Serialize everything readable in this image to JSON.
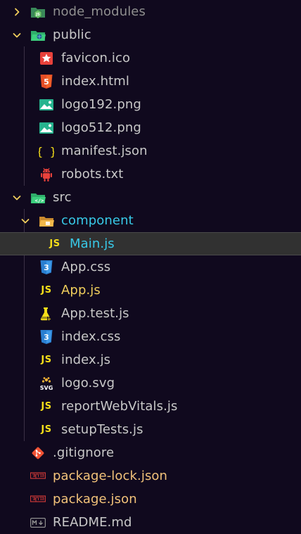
{
  "explorer": {
    "items": [
      {
        "label": "node_modules",
        "icon": "node-folder-icon",
        "color": "#8f8f8f"
      },
      {
        "label": "public",
        "icon": "public-folder-icon",
        "color": "#c8c8c8"
      },
      {
        "label": "favicon.ico",
        "icon": "favicon-star-icon",
        "color": "#c8c8c8"
      },
      {
        "label": "index.html",
        "icon": "html5-icon",
        "color": "#c8c8c8"
      },
      {
        "label": "logo192.png",
        "icon": "image-icon",
        "color": "#c8c8c8"
      },
      {
        "label": "logo512.png",
        "icon": "image-icon",
        "color": "#c8c8c8"
      },
      {
        "label": "manifest.json",
        "icon": "json-braces-icon",
        "color": "#c8c8c8"
      },
      {
        "label": "robots.txt",
        "icon": "robot-icon",
        "color": "#c8c8c8"
      },
      {
        "label": "src",
        "icon": "src-folder-icon",
        "color": "#c8c8c8"
      },
      {
        "label": "component",
        "icon": "component-folder-icon",
        "color": "#38c9e8"
      },
      {
        "label": "Main.js",
        "icon": "js-icon",
        "color": "#38c9e8"
      },
      {
        "label": "App.css",
        "icon": "css3-icon",
        "color": "#c8c8c8"
      },
      {
        "label": "App.js",
        "icon": "js-icon",
        "color": "#f0ce5c"
      },
      {
        "label": "App.test.js",
        "icon": "test-js-icon",
        "color": "#c8c8c8"
      },
      {
        "label": "index.css",
        "icon": "css3-icon",
        "color": "#c8c8c8"
      },
      {
        "label": "index.js",
        "icon": "js-icon",
        "color": "#c8c8c8"
      },
      {
        "label": "logo.svg",
        "icon": "svg-icon",
        "color": "#c8c8c8"
      },
      {
        "label": "reportWebVitals.js",
        "icon": "js-icon",
        "color": "#c8c8c8"
      },
      {
        "label": "setupTests.js",
        "icon": "js-icon",
        "color": "#c8c8c8"
      },
      {
        "label": ".gitignore",
        "icon": "git-icon",
        "color": "#c8c8c8"
      },
      {
        "label": "package-lock.json",
        "icon": "npm-icon",
        "color": "#f2c27a"
      },
      {
        "label": "package.json",
        "icon": "npm-icon",
        "color": "#f2c27a"
      },
      {
        "label": "README.md",
        "icon": "markdown-icon",
        "color": "#c8c8c8"
      }
    ],
    "js_icon_text": "JS",
    "selected": "Main.js",
    "colors": {
      "background": "#10091e",
      "selected_row": "#313131",
      "folder_green": "#2fae6a",
      "js_yellow": "#f5de19",
      "html_orange": "#e44d26",
      "css_blue": "#2a7fd1",
      "git_red": "#f05133",
      "npm_red": "#cb3837"
    }
  }
}
